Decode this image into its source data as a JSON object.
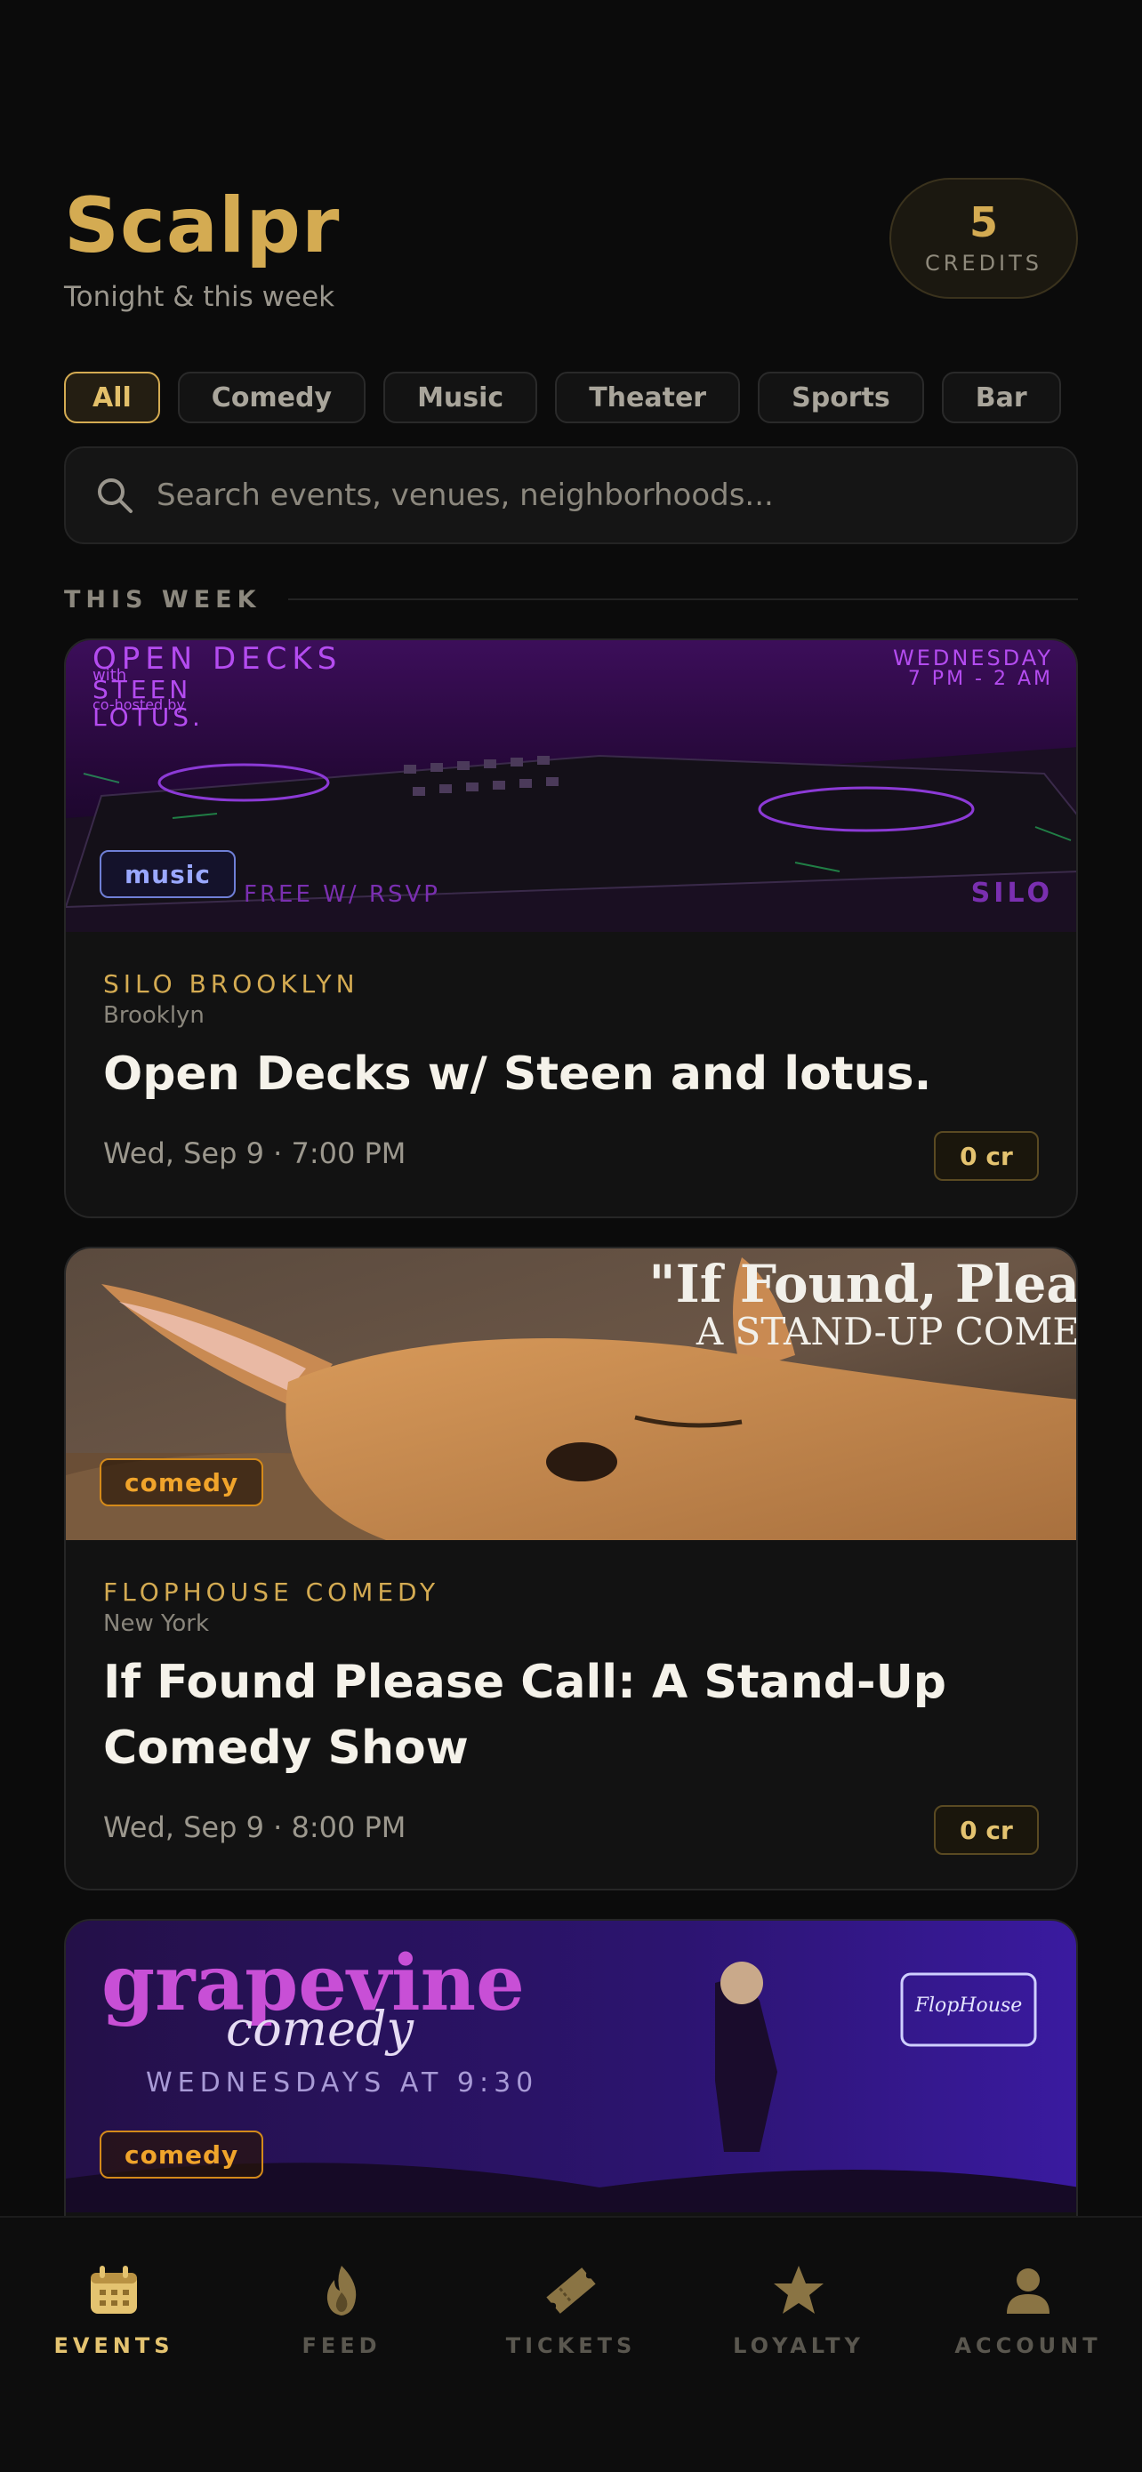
{
  "header": {
    "app_title": "Scalpr",
    "subtitle": "Tonight & this week",
    "credits_count": "5",
    "credits_label": "CREDITS"
  },
  "filters": [
    "All",
    "Comedy",
    "Music",
    "Theater",
    "Sports",
    "Bar"
  ],
  "active_filter": "All",
  "search": {
    "placeholder": "Search events, venues, neighborhoods..."
  },
  "section_title": "THIS WEEK",
  "events": [
    {
      "tag": "music",
      "venue": "SILO BROOKLYN",
      "city": "Brooklyn",
      "title": "Open Decks w/ Steen and lotus.",
      "datetime": "Wed, Sep 9 · 7:00 PM",
      "cost": "0 cr",
      "poster": {
        "headline": "OPEN DECKS",
        "line1": "with",
        "line2": "STEEN",
        "line3": "co-hosted by",
        "line4": "LOTUS.",
        "day": "WEDNESDAY",
        "hours": "7 PM - 2 AM",
        "footer_left": "FREE W/ RSVP",
        "footer_right": "SILO"
      }
    },
    {
      "tag": "comedy",
      "venue": "FLOPHOUSE COMEDY",
      "city": "New York",
      "title": "If Found Please Call: A Stand-Up Comedy Show",
      "datetime": "Wed, Sep 9 · 8:00 PM",
      "cost": "0 cr",
      "poster": {
        "line1": "\"If Found, Plea",
        "line2": "A STAND-UP COME"
      }
    },
    {
      "tag": "comedy",
      "poster": {
        "line1": "grapevine",
        "line2": "comedy",
        "line3": "WEDNESDAYS AT 9:30",
        "badge": "FlopHouse"
      }
    }
  ],
  "tabs": [
    {
      "label": "EVENTS",
      "icon": "calendar-icon",
      "active": true
    },
    {
      "label": "FEED",
      "icon": "flame-icon",
      "active": false
    },
    {
      "label": "TICKETS",
      "icon": "ticket-icon",
      "active": false
    },
    {
      "label": "LOYALTY",
      "icon": "star-icon",
      "active": false
    },
    {
      "label": "ACCOUNT",
      "icon": "person-icon",
      "active": false
    }
  ],
  "colors": {
    "accent_gold": "#d4ab52",
    "background": "#0b0b0b",
    "music_tag": "#9aa8ff",
    "comedy_tag": "#f0a42b"
  }
}
